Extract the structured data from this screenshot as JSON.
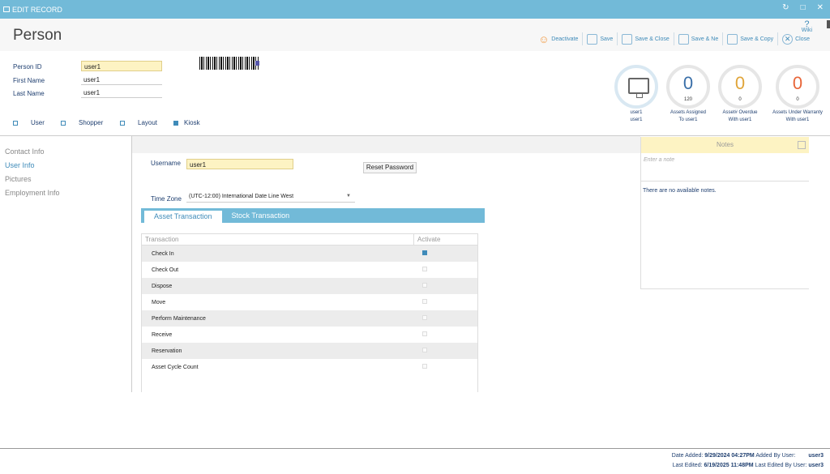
{
  "window": {
    "title": "EDIT RECORD",
    "wiki": "Wiki"
  },
  "header": {
    "title": "Person"
  },
  "toolbar": {
    "deactivate": "Deactivate",
    "save": "Save",
    "save_close": "Save & Close",
    "save_new": "Save & Ne",
    "save_copy": "Save & Copy",
    "close": "Close"
  },
  "fields": {
    "person_id": {
      "label": "Person ID",
      "value": "user1"
    },
    "first_name": {
      "label": "First Name",
      "value": "user1"
    },
    "last_name": {
      "label": "Last Name",
      "value": "user1"
    }
  },
  "roles": [
    {
      "label": "User",
      "checked": false
    },
    {
      "label": "Shopper",
      "checked": false
    },
    {
      "label": "Layout",
      "checked": false
    },
    {
      "label": "Kiosk",
      "checked": true
    }
  ],
  "stats": {
    "user": {
      "line1": "user1",
      "line2": "user1"
    },
    "assigned": {
      "value": "0",
      "sub": "120",
      "cap1": "Assets Assigned",
      "cap2": "To user1",
      "color": "#3a6fa8"
    },
    "overdue": {
      "value": "0",
      "sub": "0",
      "cap1": "Asset# Overdue",
      "cap2": "With user1",
      "color": "#e0a53a"
    },
    "warranty": {
      "value": "0",
      "sub": "0",
      "cap1": "Assets Under Warranty",
      "cap2": "With user1",
      "color": "#e8663a"
    }
  },
  "sidenav": [
    "Contact Info",
    "User Info",
    "Pictures",
    "Employment Info"
  ],
  "main": {
    "username_label": "Username",
    "username_value": "user1",
    "reset_password": "Reset Password",
    "timezone_label": "Time Zone",
    "timezone_value": "(UTC-12:00) International Date Line West",
    "tabs": [
      "Asset Transaction",
      "Stock Transaction"
    ],
    "grid": {
      "headers": [
        "Transaction",
        "Activate"
      ],
      "rows": [
        {
          "name": "Check In",
          "checked": true
        },
        {
          "name": "Check Out",
          "checked": false
        },
        {
          "name": "Dispose",
          "checked": false
        },
        {
          "name": "Move",
          "checked": false
        },
        {
          "name": "Perform Maintenance",
          "checked": false
        },
        {
          "name": "Receive",
          "checked": false
        },
        {
          "name": "Reservation",
          "checked": false
        },
        {
          "name": "Asset Cycle Count",
          "checked": false
        }
      ]
    }
  },
  "notes": {
    "title": "Notes",
    "placeholder": "Enter a note",
    "empty": "There are no available notes."
  },
  "footer": {
    "added_label": "Date Added:",
    "added_date": "9/29/2024 04:27PM",
    "added_by_label": "Added By User:",
    "added_by": "user3",
    "edited_label": "Last Edited:",
    "edited_date": "6/19/2025 11:48PM",
    "edited_by_label": "Last Edited By User:",
    "edited_by": "user3"
  }
}
